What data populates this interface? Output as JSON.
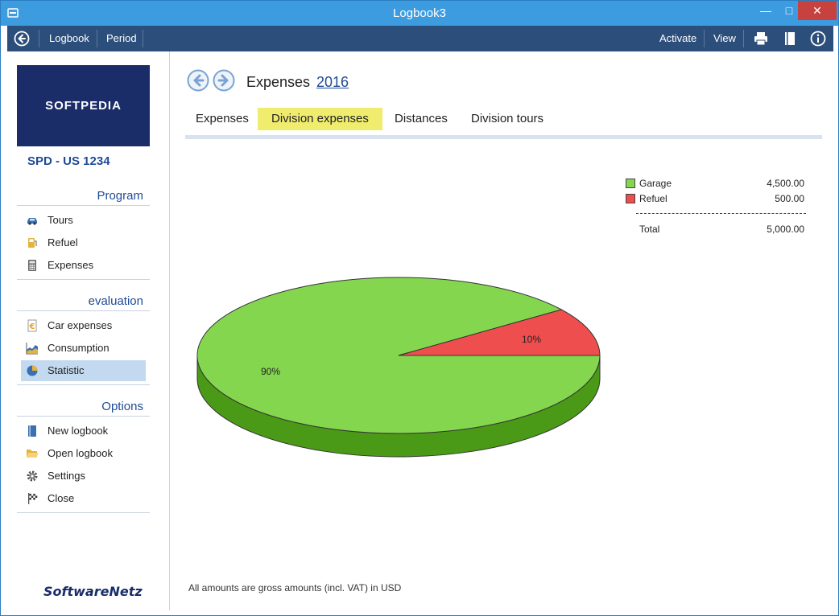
{
  "window": {
    "title": "Logbook3"
  },
  "toolbar": {
    "logbook_label": "Logbook",
    "period_label": "Period",
    "activate_label": "Activate",
    "view_label": "View"
  },
  "sidebar": {
    "logo_text": "SOFTPEDIA",
    "plate": "SPD - US 1234",
    "program": {
      "title": "Program",
      "items": [
        {
          "label": "Tours",
          "icon": "car-icon"
        },
        {
          "label": "Refuel",
          "icon": "fuel-pump-icon"
        },
        {
          "label": "Expenses",
          "icon": "calculator-icon"
        }
      ]
    },
    "evaluation": {
      "title": "evaluation",
      "items": [
        {
          "label": "Car expenses",
          "icon": "euro-document-icon"
        },
        {
          "label": "Consumption",
          "icon": "area-chart-icon"
        },
        {
          "label": "Statistic",
          "icon": "pie-chart-icon"
        }
      ]
    },
    "options": {
      "title": "Options",
      "items": [
        {
          "label": "New logbook",
          "icon": "book-icon"
        },
        {
          "label": "Open logbook",
          "icon": "folder-open-icon"
        },
        {
          "label": "Settings",
          "icon": "gear-icon"
        },
        {
          "label": "Close",
          "icon": "checkered-flag-icon"
        }
      ]
    },
    "brand": "SoftwareNetz"
  },
  "main": {
    "heading": "Expenses",
    "year": "2016",
    "tabs": [
      {
        "label": "Expenses"
      },
      {
        "label": "Division expenses",
        "active": true
      },
      {
        "label": "Distances"
      },
      {
        "label": "Division tours"
      }
    ],
    "footnote": "All amounts are gross amounts (incl. VAT) in USD"
  },
  "legend": {
    "items": [
      {
        "name": "Garage",
        "value": "4,500.00",
        "color": "#84d64f"
      },
      {
        "name": "Refuel",
        "value": "500.00",
        "color": "#ef4e4e"
      }
    ],
    "total_label": "Total",
    "total_value": "5,000.00"
  },
  "chart_data": {
    "type": "pie",
    "categories": [
      "Garage",
      "Refuel"
    ],
    "values": [
      4500.0,
      500.0
    ],
    "labels": [
      "90%",
      "10%"
    ],
    "colors": [
      "#84d64f",
      "#ef4e4e"
    ],
    "side_colors": [
      "#4a9a17",
      "#b73434"
    ]
  }
}
